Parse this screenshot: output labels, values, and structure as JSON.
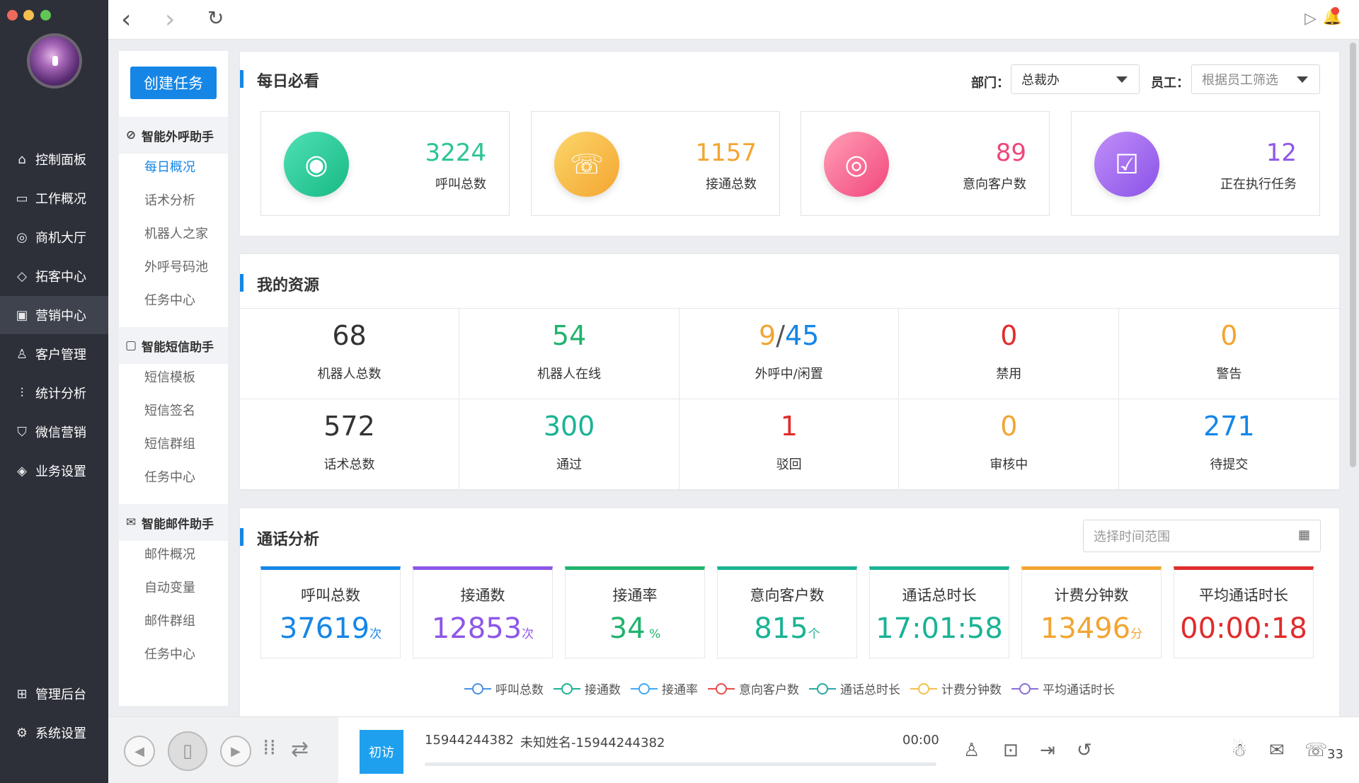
{
  "colors": {
    "accent": "#1586e6",
    "sidebar": "#2d3039"
  },
  "sidebar": {
    "items": [
      {
        "label": "控制面板",
        "icon": "dashboard-icon",
        "glyph": "⌂"
      },
      {
        "label": "工作概况",
        "icon": "monitor-icon",
        "glyph": "▭"
      },
      {
        "label": "商机大厅",
        "icon": "opportunity-icon",
        "glyph": "◎"
      },
      {
        "label": "拓客中心",
        "icon": "pulse-icon",
        "glyph": "◇"
      },
      {
        "label": "营销中心",
        "icon": "marketing-icon",
        "glyph": "▣"
      },
      {
        "label": "客户管理",
        "icon": "user-icon",
        "glyph": "♙"
      },
      {
        "label": "统计分析",
        "icon": "bar-chart-icon",
        "glyph": "⫶"
      },
      {
        "label": "微信营销",
        "icon": "shield-icon",
        "glyph": "⛉"
      },
      {
        "label": "业务设置",
        "icon": "layers-icon",
        "glyph": "◈"
      }
    ],
    "bottom_items": [
      {
        "label": "管理后台",
        "icon": "grid-icon",
        "glyph": "⊞"
      },
      {
        "label": "系统设置",
        "icon": "gear-icon",
        "glyph": "⚙"
      }
    ]
  },
  "topbar": {
    "back": "‹",
    "forward": "›",
    "refresh": "↻",
    "screen": "▷",
    "bell": "🔔"
  },
  "subnav": {
    "create_button": "创建任务",
    "sections": [
      {
        "title": "智能外呼助手",
        "glyph": "⊘",
        "items": [
          "每日概况",
          "话术分析",
          "机器人之家",
          "外呼号码池",
          "任务中心"
        ]
      },
      {
        "title": "智能短信助手",
        "glyph": "▢",
        "items": [
          "短信模板",
          "短信签名",
          "短信群组",
          "任务中心"
        ]
      },
      {
        "title": "智能邮件助手",
        "glyph": "✉",
        "items": [
          "邮件概况",
          "自动变量",
          "邮件群组",
          "任务中心"
        ]
      }
    ]
  },
  "daily": {
    "title": "每日必看",
    "dept_label": "部门：",
    "dept_value": "总裁办",
    "staff_label": "员工：",
    "staff_placeholder": "根据员工筛选",
    "cards": [
      {
        "value": "3224",
        "label": "呼叫总数",
        "color": "#2dc395",
        "grad": "linear-gradient(135deg,#4fe0b4,#18b985)",
        "glyph": "◉"
      },
      {
        "value": "1157",
        "label": "接通总数",
        "color": "#f2a532",
        "grad": "linear-gradient(135deg,#fbd66a,#f4a530)",
        "glyph": "☏"
      },
      {
        "value": "89",
        "label": "意向客户数",
        "color": "#f0457a",
        "grad": "linear-gradient(135deg,#ff9fb6,#f2467c)",
        "glyph": "◎"
      },
      {
        "value": "12",
        "label": "正在执行任务",
        "color": "#8e56e8",
        "grad": "linear-gradient(135deg,#c18ef8,#8a52e8)",
        "glyph": "☑"
      }
    ]
  },
  "resources": {
    "title": "我的资源",
    "cells": [
      {
        "value": "68",
        "label": "机器人总数",
        "color": "#333333"
      },
      {
        "value": "54",
        "label": "机器人在线",
        "color": "#22b36e"
      },
      {
        "value_a": "9",
        "sep": "/",
        "value_b": "45",
        "label": "外呼中/闲置",
        "color_a": "#f2a532",
        "color_b": "#1586e6"
      },
      {
        "value": "0",
        "label": "禁用",
        "color": "#e02c2c"
      },
      {
        "value": "0",
        "label": "警告",
        "color": "#f2a532"
      },
      {
        "value": "572",
        "label": "话术总数",
        "color": "#333333"
      },
      {
        "value": "300",
        "label": "通过",
        "color": "#1ab394"
      },
      {
        "value": "1",
        "label": "驳回",
        "color": "#e02c2c"
      },
      {
        "value": "0",
        "label": "审核中",
        "color": "#f2a532"
      },
      {
        "value": "271",
        "label": "待提交",
        "color": "#1586e6"
      }
    ]
  },
  "call_analysis": {
    "title": "通话分析",
    "date_placeholder": "选择时间范围",
    "cards": [
      {
        "label": "呼叫总数",
        "value": "37619",
        "unit": "次",
        "color": "#1586e6"
      },
      {
        "label": "接通数",
        "value": "12853",
        "unit": "次",
        "color": "#8e56e8"
      },
      {
        "label": "接通率",
        "value": "34",
        "unit": " %",
        "color": "#22b36e"
      },
      {
        "label": "意向客户数",
        "value": "815",
        "unit": "个",
        "color": "#1ab394"
      },
      {
        "label": "通话总时长",
        "value": "17:01:58",
        "unit": "",
        "color": "#1ab394"
      },
      {
        "label": "计费分钟数",
        "value": "13496",
        "unit": "分",
        "color": "#f2a532"
      },
      {
        "label": "平均通话时长",
        "value": "00:00:18",
        "unit": "",
        "color": "#e02c2c"
      }
    ],
    "legend": [
      {
        "label": "呼叫总数",
        "color": "#4a90e2"
      },
      {
        "label": "接通数",
        "color": "#1ab394"
      },
      {
        "label": "接通率",
        "color": "#3fa9f5"
      },
      {
        "label": "意向客户数",
        "color": "#e84c4c"
      },
      {
        "label": "通话总时长",
        "color": "#2aa9a0"
      },
      {
        "label": "计费分钟数",
        "color": "#f2c04a"
      },
      {
        "label": "平均通话时长",
        "color": "#8a6ed8"
      }
    ]
  },
  "callbar": {
    "chip": "初访",
    "phone": "15944244382",
    "name": "未知姓名-15944244382",
    "timer": "00:00",
    "count": "33"
  }
}
